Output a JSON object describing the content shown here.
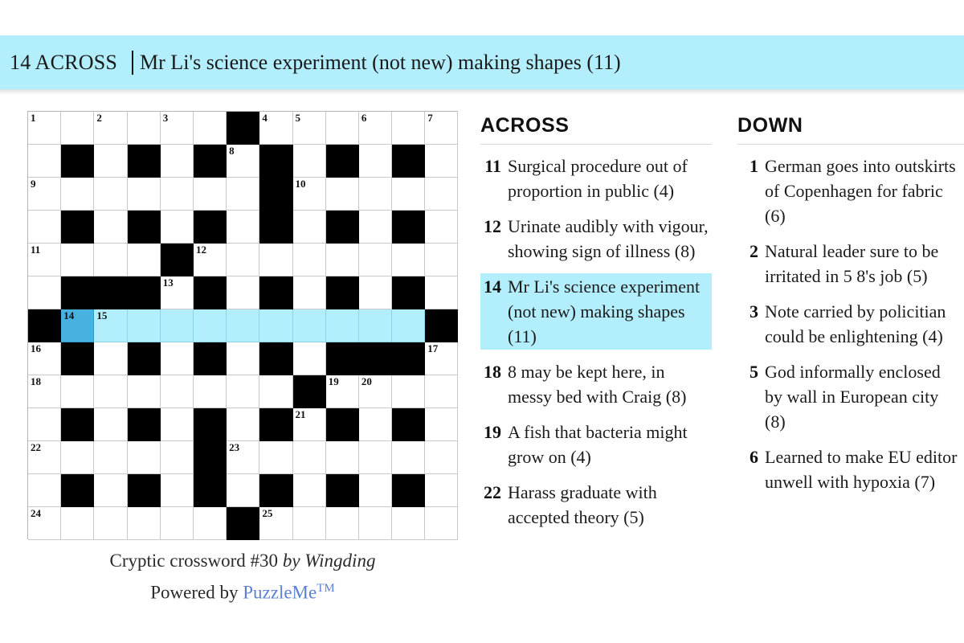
{
  "banner": {
    "number_label": "14 ACROSS",
    "separator": "|",
    "clue_text": "Mr Li's science experiment (not new) making shapes (11)",
    "background_color": "#b3eefc"
  },
  "grid": {
    "rows": 13,
    "cols": 13,
    "colors": {
      "block": "#000000",
      "empty": "#ffffff",
      "highlight": "#b3eefc",
      "active": "#47b2df",
      "border": "#c9c9c9"
    },
    "cells": [
      [
        {
          "t": "o",
          "n": "1"
        },
        {
          "t": "o"
        },
        {
          "t": "o",
          "n": "2"
        },
        {
          "t": "o"
        },
        {
          "t": "o",
          "n": "3"
        },
        {
          "t": "o"
        },
        {
          "t": "b"
        },
        {
          "t": "o",
          "n": "4"
        },
        {
          "t": "o",
          "n": "5"
        },
        {
          "t": "o"
        },
        {
          "t": "o",
          "n": "6"
        },
        {
          "t": "o"
        },
        {
          "t": "o",
          "n": "7"
        }
      ],
      [
        {
          "t": "o"
        },
        {
          "t": "b"
        },
        {
          "t": "o"
        },
        {
          "t": "b"
        },
        {
          "t": "o"
        },
        {
          "t": "b"
        },
        {
          "t": "o",
          "n": "8"
        },
        {
          "t": "b"
        },
        {
          "t": "o"
        },
        {
          "t": "b"
        },
        {
          "t": "o"
        },
        {
          "t": "b"
        },
        {
          "t": "o"
        }
      ],
      [
        {
          "t": "o",
          "n": "9"
        },
        {
          "t": "o"
        },
        {
          "t": "o"
        },
        {
          "t": "o"
        },
        {
          "t": "o"
        },
        {
          "t": "o"
        },
        {
          "t": "o"
        },
        {
          "t": "b"
        },
        {
          "t": "o",
          "n": "10"
        },
        {
          "t": "o"
        },
        {
          "t": "o"
        },
        {
          "t": "o"
        },
        {
          "t": "o"
        }
      ],
      [
        {
          "t": "o"
        },
        {
          "t": "b"
        },
        {
          "t": "o"
        },
        {
          "t": "b"
        },
        {
          "t": "o"
        },
        {
          "t": "b"
        },
        {
          "t": "o"
        },
        {
          "t": "b"
        },
        {
          "t": "o"
        },
        {
          "t": "b"
        },
        {
          "t": "o"
        },
        {
          "t": "b"
        },
        {
          "t": "o"
        }
      ],
      [
        {
          "t": "o",
          "n": "11"
        },
        {
          "t": "o"
        },
        {
          "t": "o"
        },
        {
          "t": "o"
        },
        {
          "t": "b"
        },
        {
          "t": "o",
          "n": "12"
        },
        {
          "t": "o"
        },
        {
          "t": "o"
        },
        {
          "t": "o"
        },
        {
          "t": "o"
        },
        {
          "t": "o"
        },
        {
          "t": "o"
        },
        {
          "t": "o"
        }
      ],
      [
        {
          "t": "o"
        },
        {
          "t": "b"
        },
        {
          "t": "b"
        },
        {
          "t": "b"
        },
        {
          "t": "o",
          "n": "13"
        },
        {
          "t": "b"
        },
        {
          "t": "o"
        },
        {
          "t": "b"
        },
        {
          "t": "o"
        },
        {
          "t": "b"
        },
        {
          "t": "o"
        },
        {
          "t": "b"
        },
        {
          "t": "o"
        }
      ],
      [
        {
          "t": "b"
        },
        {
          "t": "a",
          "n": "14"
        },
        {
          "t": "h",
          "n": "15"
        },
        {
          "t": "h"
        },
        {
          "t": "h"
        },
        {
          "t": "h"
        },
        {
          "t": "h"
        },
        {
          "t": "h"
        },
        {
          "t": "h"
        },
        {
          "t": "h"
        },
        {
          "t": "h"
        },
        {
          "t": "h"
        },
        {
          "t": "b"
        }
      ],
      [
        {
          "t": "o",
          "n": "16"
        },
        {
          "t": "b"
        },
        {
          "t": "o"
        },
        {
          "t": "b"
        },
        {
          "t": "o"
        },
        {
          "t": "b"
        },
        {
          "t": "o"
        },
        {
          "t": "b"
        },
        {
          "t": "o"
        },
        {
          "t": "b"
        },
        {
          "t": "b"
        },
        {
          "t": "b"
        },
        {
          "t": "o",
          "n": "17"
        }
      ],
      [
        {
          "t": "o",
          "n": "18"
        },
        {
          "t": "o"
        },
        {
          "t": "o"
        },
        {
          "t": "o"
        },
        {
          "t": "o"
        },
        {
          "t": "o"
        },
        {
          "t": "o"
        },
        {
          "t": "o"
        },
        {
          "t": "b"
        },
        {
          "t": "o",
          "n": "19"
        },
        {
          "t": "o",
          "n": "20"
        },
        {
          "t": "o"
        },
        {
          "t": "o"
        }
      ],
      [
        {
          "t": "o"
        },
        {
          "t": "b"
        },
        {
          "t": "o"
        },
        {
          "t": "b"
        },
        {
          "t": "o"
        },
        {
          "t": "b"
        },
        {
          "t": "o"
        },
        {
          "t": "b"
        },
        {
          "t": "o",
          "n": "21"
        },
        {
          "t": "b"
        },
        {
          "t": "o"
        },
        {
          "t": "b"
        },
        {
          "t": "o"
        }
      ],
      [
        {
          "t": "o",
          "n": "22"
        },
        {
          "t": "o"
        },
        {
          "t": "o"
        },
        {
          "t": "o"
        },
        {
          "t": "o"
        },
        {
          "t": "b"
        },
        {
          "t": "o",
          "n": "23"
        },
        {
          "t": "o"
        },
        {
          "t": "o"
        },
        {
          "t": "o"
        },
        {
          "t": "o"
        },
        {
          "t": "o"
        },
        {
          "t": "o"
        }
      ],
      [
        {
          "t": "o"
        },
        {
          "t": "b"
        },
        {
          "t": "o"
        },
        {
          "t": "b"
        },
        {
          "t": "o"
        },
        {
          "t": "b"
        },
        {
          "t": "o"
        },
        {
          "t": "b"
        },
        {
          "t": "o"
        },
        {
          "t": "b"
        },
        {
          "t": "o"
        },
        {
          "t": "b"
        },
        {
          "t": "o"
        }
      ],
      [
        {
          "t": "o",
          "n": "24"
        },
        {
          "t": "o"
        },
        {
          "t": "o"
        },
        {
          "t": "o"
        },
        {
          "t": "o"
        },
        {
          "t": "o"
        },
        {
          "t": "b"
        },
        {
          "t": "o",
          "n": "25"
        },
        {
          "t": "o"
        },
        {
          "t": "o"
        },
        {
          "t": "o"
        },
        {
          "t": "o"
        },
        {
          "t": "o"
        }
      ]
    ]
  },
  "caption": {
    "title": "Cryptic crossword #30 ",
    "byline": "by Wingding",
    "powered_prefix": "Powered by ",
    "powered_brand": "PuzzleMe",
    "powered_tm": "TM"
  },
  "across": {
    "heading": "ACROSS",
    "clues": [
      {
        "number": "11",
        "text": "Surgical procedure out of proportion in public (4)",
        "selected": false
      },
      {
        "number": "12",
        "text": "Urinate audibly with vigour, showing sign of illness (8)",
        "selected": false
      },
      {
        "number": "14",
        "text": "Mr Li's science experiment (not new) making shapes (11)",
        "selected": true
      },
      {
        "number": "18",
        "text": "8 may be kept here, in messy bed with Craig (8)",
        "selected": false
      },
      {
        "number": "19",
        "text": "A fish that bacteria might grow on (4)",
        "selected": false
      },
      {
        "number": "22",
        "text": "Harass graduate with accepted theory (5)",
        "selected": false
      }
    ]
  },
  "down": {
    "heading": "DOWN",
    "clues": [
      {
        "number": "1",
        "text": "German goes into outskirts of Copenhagen for fabric (6)",
        "selected": false
      },
      {
        "number": "2",
        "text": "Natural leader sure to be irritated in 5 8's job (5)",
        "selected": false
      },
      {
        "number": "3",
        "text": "Note carried by policitian could be enlightening (4)",
        "selected": false
      },
      {
        "number": "5",
        "text": "God informally enclosed by wall in European city (8)",
        "selected": false
      },
      {
        "number": "6",
        "text": "Learned to make EU editor unwell with hypoxia (7)",
        "selected": false
      }
    ]
  }
}
